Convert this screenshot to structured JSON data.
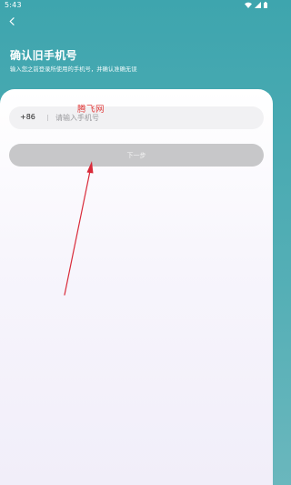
{
  "status_bar": {
    "time": "5:43",
    "icons": [
      "wifi-icon",
      "signal-icon",
      "battery-icon"
    ]
  },
  "header": {
    "back_icon": "chevron-left-icon",
    "title": "确认旧手机号",
    "subtitle": "输入您之前登录所使用的手机号，并确认准确无误"
  },
  "form": {
    "country_code": "+86",
    "phone_placeholder": "请输入手机号",
    "phone_value": "",
    "next_label": "下一步"
  },
  "watermark": {
    "text": "腾飞网"
  },
  "colors": {
    "header_teal": "#3ea5ae",
    "button_disabled": "#c7c7c9",
    "field_background": "#f1f1f3",
    "annotation_red": "#d92b3a"
  }
}
